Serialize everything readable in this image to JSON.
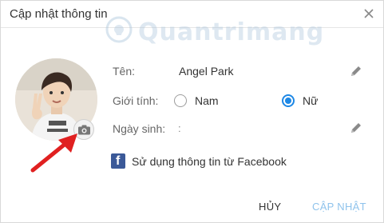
{
  "dialog": {
    "title": "Cập nhật thông tin",
    "close_icon": "close-icon"
  },
  "watermark": {
    "text": "Quantrimang"
  },
  "avatar": {
    "camera_icon": "camera-icon"
  },
  "form": {
    "name_label": "Tên:",
    "name_value": "Angel Park",
    "gender_label": "Giới tính:",
    "gender_options": [
      "Nam",
      "Nữ"
    ],
    "gender_selected": "Nữ",
    "dob_label": "Ngày sinh:",
    "dob_value": ":"
  },
  "facebook": {
    "label": "Sử dụng thông tin từ Facebook",
    "icon": "facebook-icon"
  },
  "buttons": {
    "cancel": "HỦY",
    "update": "CẬP NHẬT"
  },
  "colors": {
    "accent": "#1e88e5",
    "update_disabled": "#8fc3ec",
    "facebook": "#3b5998",
    "arrow": "#e02020"
  }
}
